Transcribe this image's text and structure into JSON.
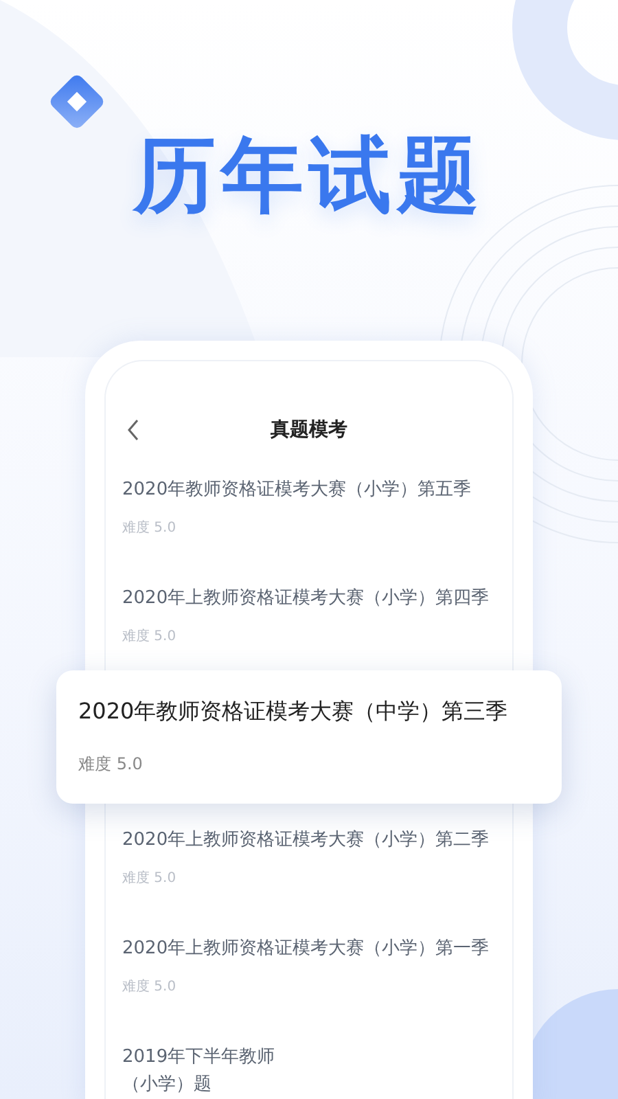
{
  "headline": "历年试题",
  "screen": {
    "title": "真题模考",
    "items": [
      {
        "title": "2020年教师资格证模考大赛（小学）第五季",
        "difficulty": "难度 5.0",
        "highlighted": false
      },
      {
        "title": "2020年上教师资格证模考大赛（小学）第四季",
        "difficulty": "难度 5.0",
        "highlighted": false
      },
      {
        "title": "2020年教师资格证模考大赛（中学）第三季",
        "difficulty": "难度 5.0",
        "highlighted": true
      },
      {
        "title": "2020年上教师资格证模考大赛（小学）第二季",
        "difficulty": "难度 5.0",
        "highlighted": false
      },
      {
        "title": "2020年上教师资格证模考大赛（小学）第一季",
        "difficulty": "难度 5.0",
        "highlighted": false
      },
      {
        "title": "2019年下半年教师",
        "title_continued": "（小学）题",
        "highlighted": false
      }
    ]
  }
}
